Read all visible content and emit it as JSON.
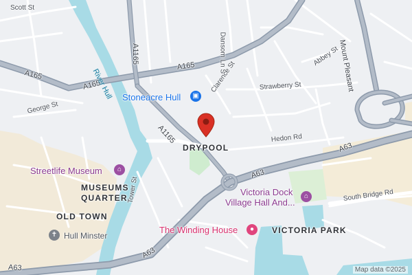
{
  "streets": {
    "scott_st": "Scott St",
    "a1165_vertical": "A1165",
    "a165_west": "A165",
    "a165_mid": "A165",
    "a165_north": "A165",
    "george_st": "George St",
    "dansom_ln": "Dansom Ln S",
    "clarence_st": "Clarence St",
    "abbey_st": "Abbey St",
    "strawberry_st": "Strawberry St",
    "mount_pleasant": "Mount Pleasant",
    "a1165_diag": "A1165",
    "hedon_rd": "Hedon Rd",
    "a63_east": "A63",
    "a63_mid": "A63",
    "a63_south": "A63",
    "a63_west": "A63",
    "tower_st": "Tower St",
    "south_bridge_rd": "South Bridge Rd",
    "river_hull": "River Hull"
  },
  "districts": {
    "drypool": "DRYPOOL",
    "museums_quarter_1": "MUSEUMS",
    "museums_quarter_2": "QUARTER",
    "old_town": "OLD TOWN",
    "victoria_park": "VICTORIA PARK"
  },
  "pois": {
    "stoneacre": {
      "label": "Stoneacre Hull",
      "icon": "shopping-bag-icon",
      "color": "#1a73e8"
    },
    "streetlife": {
      "label": "Streetlife Museum",
      "icon": "museum-icon",
      "color": "#9c4fa2"
    },
    "victoria_dock_1": {
      "label": "Victoria Dock",
      "icon": "landmark-icon",
      "color": "#9c4fa2"
    },
    "victoria_dock_2": {
      "label": "Village Hall And...",
      "icon": "landmark-icon",
      "color": "#9c4fa2"
    },
    "winding_house": {
      "label": "The Winding House",
      "icon": "lodging-icon",
      "color": "#e0457d"
    },
    "hull_minster": {
      "label": "Hull Minster",
      "icon": "church-icon",
      "color": "#7c828a"
    }
  },
  "marker": {
    "icon": "location-pin-icon",
    "color": "#d93025"
  },
  "attribution": "Map data ©2025"
}
